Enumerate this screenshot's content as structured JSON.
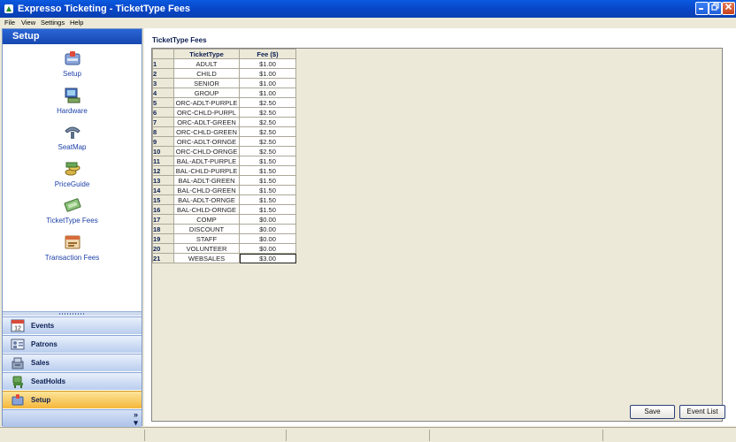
{
  "window": {
    "title": "Expresso Ticketing - TicketType Fees"
  },
  "menu": [
    "File",
    "View",
    "Settings",
    "Help"
  ],
  "sidebar": {
    "header": "Setup",
    "items": [
      {
        "label": "Setup",
        "icon": "setup-icon"
      },
      {
        "label": "Hardware",
        "icon": "hardware-icon"
      },
      {
        "label": "SeatMap",
        "icon": "seatmap-icon"
      },
      {
        "label": "PriceGuide",
        "icon": "price-guide-icon"
      },
      {
        "label": "TicketType Fees",
        "icon": "ticket-icon"
      },
      {
        "label": "Transaction Fees",
        "icon": "transaction-icon"
      }
    ],
    "bars": [
      {
        "label": "Events",
        "icon": "calendar-icon",
        "active": false
      },
      {
        "label": "Patrons",
        "icon": "patrons-icon",
        "active": false
      },
      {
        "label": "Sales",
        "icon": "sales-icon",
        "active": false
      },
      {
        "label": "SeatHolds",
        "icon": "seatholds-icon",
        "active": false
      },
      {
        "label": "Setup",
        "icon": "setup-icon",
        "active": true
      }
    ],
    "more": "»"
  },
  "main": {
    "title": "TicketType Fees",
    "columns": [
      "TicketType",
      "Fee ($)"
    ],
    "rows": [
      {
        "n": "1",
        "type": "ADULT",
        "fee": "$1.00"
      },
      {
        "n": "2",
        "type": "CHILD",
        "fee": "$1.00"
      },
      {
        "n": "3",
        "type": "SENIOR",
        "fee": "$1.00"
      },
      {
        "n": "4",
        "type": "GROUP",
        "fee": "$1.00"
      },
      {
        "n": "5",
        "type": "ORC-ADLT-PURPLE",
        "fee": "$2.50"
      },
      {
        "n": "6",
        "type": "ORC-CHLD-PURPL",
        "fee": "$2.50"
      },
      {
        "n": "7",
        "type": "ORC-ADLT-GREEN",
        "fee": "$2.50"
      },
      {
        "n": "8",
        "type": "ORC-CHLD-GREEN",
        "fee": "$2.50"
      },
      {
        "n": "9",
        "type": "ORC-ADLT-ORNGE",
        "fee": "$2.50"
      },
      {
        "n": "10",
        "type": "ORC-CHLD-ORNGE",
        "fee": "$2.50"
      },
      {
        "n": "11",
        "type": "BAL-ADLT-PURPLE",
        "fee": "$1.50"
      },
      {
        "n": "12",
        "type": "BAL-CHLD-PURPLE",
        "fee": "$1.50"
      },
      {
        "n": "13",
        "type": "BAL-ADLT-GREEN",
        "fee": "$1.50"
      },
      {
        "n": "14",
        "type": "BAL-CHLD-GREEN",
        "fee": "$1.50"
      },
      {
        "n": "15",
        "type": "BAL-ADLT-ORNGE",
        "fee": "$1.50"
      },
      {
        "n": "16",
        "type": "BAL-CHLD-ORNGE",
        "fee": "$1.50"
      },
      {
        "n": "17",
        "type": "COMP",
        "fee": "$0.00"
      },
      {
        "n": "18",
        "type": "DISCOUNT",
        "fee": "$0.00"
      },
      {
        "n": "19",
        "type": "STAFF",
        "fee": "$0.00"
      },
      {
        "n": "20",
        "type": "VOLUNTEER",
        "fee": "$0.00"
      },
      {
        "n": "21",
        "type": "WEBSALES",
        "fee": "$3.00"
      }
    ],
    "save_label": "Save",
    "event_list_label": "Event List"
  },
  "colors": {
    "accent": "#1647b0",
    "active_bar": "#f5b73a",
    "link": "#1b3fa8"
  }
}
